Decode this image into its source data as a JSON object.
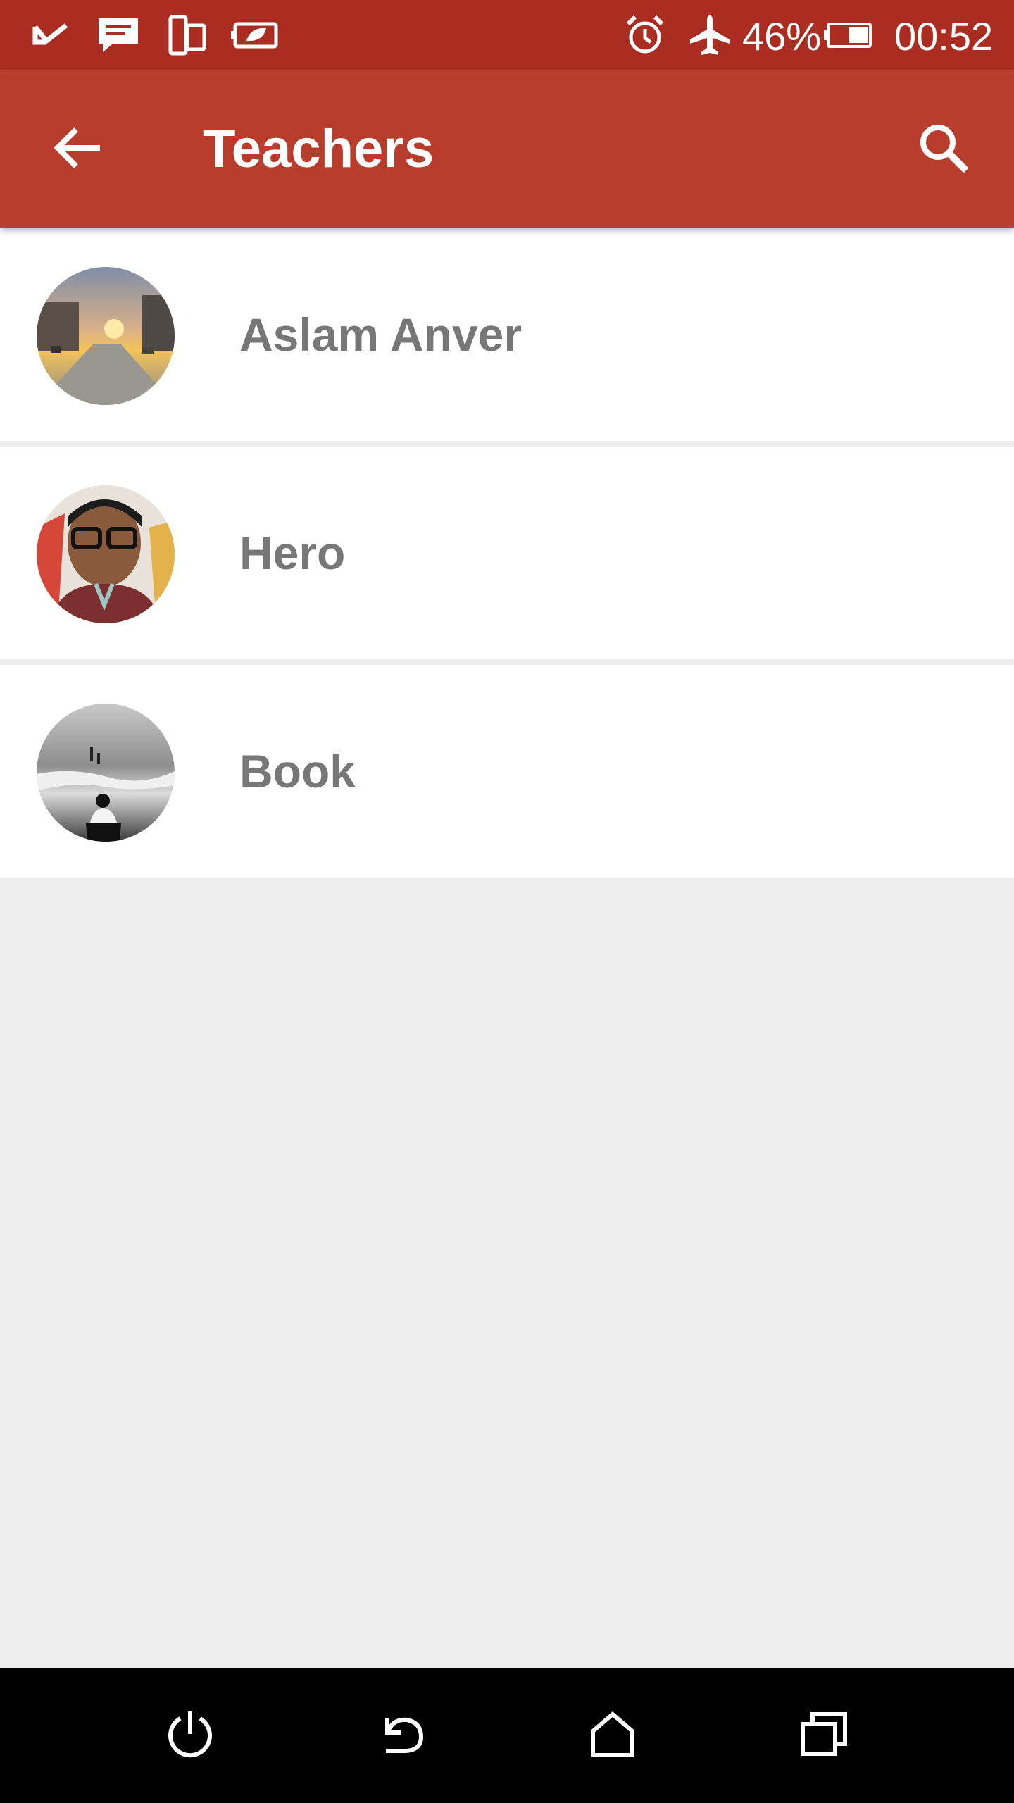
{
  "status_bar": {
    "battery_percent": "46%",
    "time": "00:52",
    "icons": [
      "check-icon",
      "message-icon",
      "dual-device-icon",
      "eco-battery-icon",
      "alarm-icon",
      "airplane-mode-icon",
      "battery-icon"
    ]
  },
  "app_bar": {
    "title": "Teachers",
    "back_icon": "arrow-back-icon",
    "search_icon": "search-icon"
  },
  "teachers": [
    {
      "name": "Aslam Anver",
      "avatar": "street-sunset-photo"
    },
    {
      "name": "Hero",
      "avatar": "man-with-glasses-photo"
    },
    {
      "name": "Book",
      "avatar": "beach-bw-photo"
    }
  ],
  "nav_bar": {
    "icons": [
      "power-icon",
      "back-icon",
      "home-icon",
      "recents-icon"
    ]
  },
  "colors": {
    "status_bar": "#ab2c20",
    "app_bar": "#b93d2d",
    "background": "#ededed",
    "item_text": "#777777"
  }
}
